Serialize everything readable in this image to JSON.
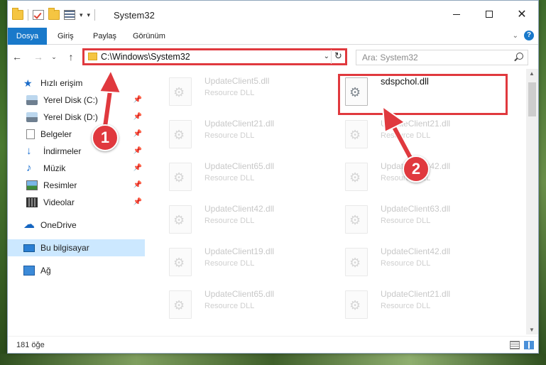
{
  "window": {
    "title": "System32"
  },
  "ribbon": {
    "tabs": [
      "Dosya",
      "Giriş",
      "Paylaş",
      "Görünüm"
    ]
  },
  "address": {
    "path": "C:\\Windows\\System32",
    "search_placeholder": "Ara: System32"
  },
  "nav": {
    "items": [
      {
        "label": "Hızlı erişim",
        "icon": "star-icon"
      },
      {
        "label": "Yerel Disk (C:)",
        "icon": "drive-icon",
        "pinned": true
      },
      {
        "label": "Yerel Disk (D:)",
        "icon": "drive-icon",
        "pinned": true
      },
      {
        "label": "Belgeler",
        "icon": "documents-icon",
        "pinned": true
      },
      {
        "label": "İndirmeler",
        "icon": "downloads-icon",
        "pinned": true
      },
      {
        "label": "Müzik",
        "icon": "music-icon",
        "pinned": true
      },
      {
        "label": "Resimler",
        "icon": "pictures-icon",
        "pinned": true
      },
      {
        "label": "Videolar",
        "icon": "videos-icon",
        "pinned": true
      },
      {
        "label": "OneDrive",
        "icon": "onedrive-icon"
      },
      {
        "label": "Bu bilgisayar",
        "icon": "computer-icon",
        "selected": true
      },
      {
        "label": "Ağ",
        "icon": "network-icon"
      }
    ]
  },
  "files": {
    "left": [
      {
        "name": "UpdateClient5.dll",
        "type": "Resource DLL"
      },
      {
        "name": "UpdateClient21.dll",
        "type": "Resource DLL"
      },
      {
        "name": "UpdateClient65.dll",
        "type": "Resource DLL"
      },
      {
        "name": "UpdateClient42.dll",
        "type": "Resource DLL"
      },
      {
        "name": "UpdateClient19.dll",
        "type": "Resource DLL"
      },
      {
        "name": "UpdateClient65.dll",
        "type": "Resource DLL"
      }
    ],
    "right": [
      {
        "name": "sdspchol.dll",
        "type": ""
      },
      {
        "name": "UpdateClient21.dll",
        "type": "Resource DLL"
      },
      {
        "name": "UpdateClient42.dll",
        "type": "Resource DLL"
      },
      {
        "name": "UpdateClient63.dll",
        "type": "Resource DLL"
      },
      {
        "name": "UpdateClient42.dll",
        "type": "Resource DLL"
      },
      {
        "name": "UpdateClient21.dll",
        "type": "Resource DLL"
      }
    ]
  },
  "status": {
    "count": "181 öğe"
  },
  "callouts": {
    "one": "1",
    "two": "2",
    "color": "#e0393e"
  },
  "colors": {
    "accent": "#1979ca",
    "selection": "#cce8ff"
  }
}
